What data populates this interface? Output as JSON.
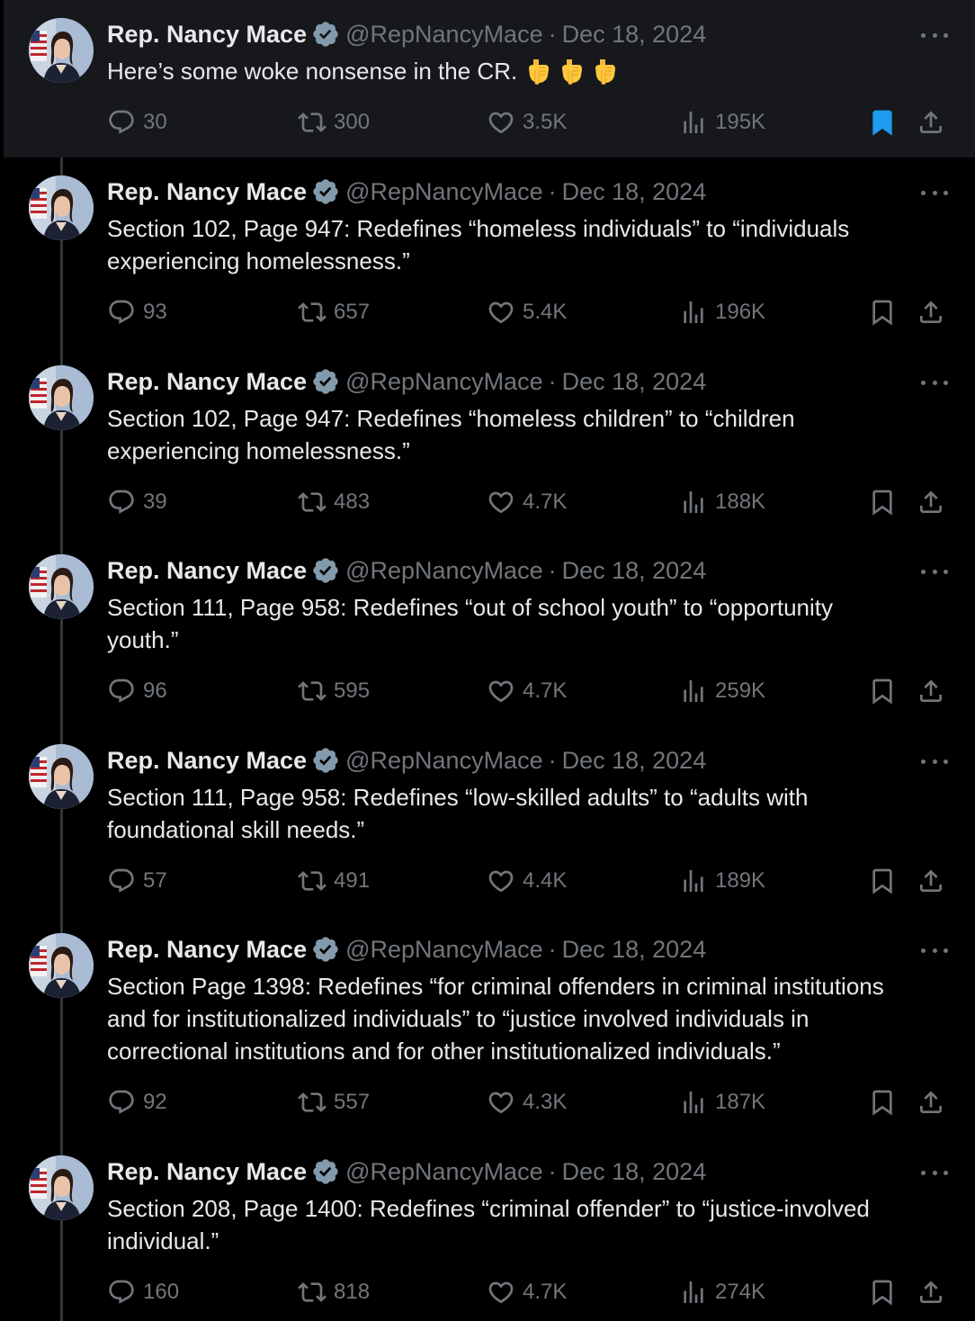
{
  "colors": {
    "background": "#000000",
    "highlight_background": "#16181c",
    "text": "#e7e9ea",
    "muted": "#71767b",
    "verified": "#829aab",
    "bookmark_active": "#1d9bf0"
  },
  "tweets": [
    {
      "name": "Rep. Nancy Mace",
      "handle": "@RepNancyMace",
      "separator": "·",
      "date": "Dec 18, 2024",
      "text": "Here’s some woke nonsense in the CR.",
      "emojis": [
        "backhand-index-pointing-down",
        "backhand-index-pointing-down",
        "backhand-index-pointing-down"
      ],
      "replies": "30",
      "reposts": "300",
      "likes": "3.5K",
      "views": "195K",
      "bookmarked": true
    },
    {
      "name": "Rep. Nancy Mace",
      "handle": "@RepNancyMace",
      "separator": "·",
      "date": "Dec 18, 2024",
      "text_lines": [
        "Section 102, Page 947: Redefines “homeless individuals” to “individuals",
        "experiencing homelessness.”"
      ],
      "replies": "93",
      "reposts": "657",
      "likes": "5.4K",
      "views": "196K",
      "bookmarked": false
    },
    {
      "name": "Rep. Nancy Mace",
      "handle": "@RepNancyMace",
      "separator": "·",
      "date": "Dec 18, 2024",
      "text_lines": [
        "Section 102, Page 947: Redefines “homeless children” to “children",
        "experiencing homelessness.”"
      ],
      "replies": "39",
      "reposts": "483",
      "likes": "4.7K",
      "views": "188K",
      "bookmarked": false
    },
    {
      "name": "Rep. Nancy Mace",
      "handle": "@RepNancyMace",
      "separator": "·",
      "date": "Dec 18, 2024",
      "text_lines": [
        "Section 111, Page 958: Redefines “out of school youth” to “opportunity",
        "youth.”"
      ],
      "replies": "96",
      "reposts": "595",
      "likes": "4.7K",
      "views": "259K",
      "bookmarked": false
    },
    {
      "name": "Rep. Nancy Mace",
      "handle": "@RepNancyMace",
      "separator": "·",
      "date": "Dec 18, 2024",
      "text_lines": [
        "Section 111, Page 958: Redefines “low-skilled adults” to “adults with",
        "foundational skill needs.”"
      ],
      "replies": "57",
      "reposts": "491",
      "likes": "4.4K",
      "views": "189K",
      "bookmarked": false
    },
    {
      "name": "Rep. Nancy Mace",
      "handle": "@RepNancyMace",
      "separator": "·",
      "date": "Dec 18, 2024",
      "text_lines": [
        "Section Page 1398: Redefines “for criminal offenders in criminal institutions",
        "and for institutionalized individuals” to “justice involved individuals in",
        "correctional institutions and for other institutionalized individuals.”"
      ],
      "replies": "92",
      "reposts": "557",
      "likes": "4.3K",
      "views": "187K",
      "bookmarked": false
    },
    {
      "name": "Rep. Nancy Mace",
      "handle": "@RepNancyMace",
      "separator": "·",
      "date": "Dec 18, 2024",
      "text_lines": [
        "Section 208, Page 1400: Redefines “criminal offender” to “justice-involved",
        "individual.”"
      ],
      "replies": "160",
      "reposts": "818",
      "likes": "4.7K",
      "views": "274K",
      "bookmarked": false
    }
  ]
}
